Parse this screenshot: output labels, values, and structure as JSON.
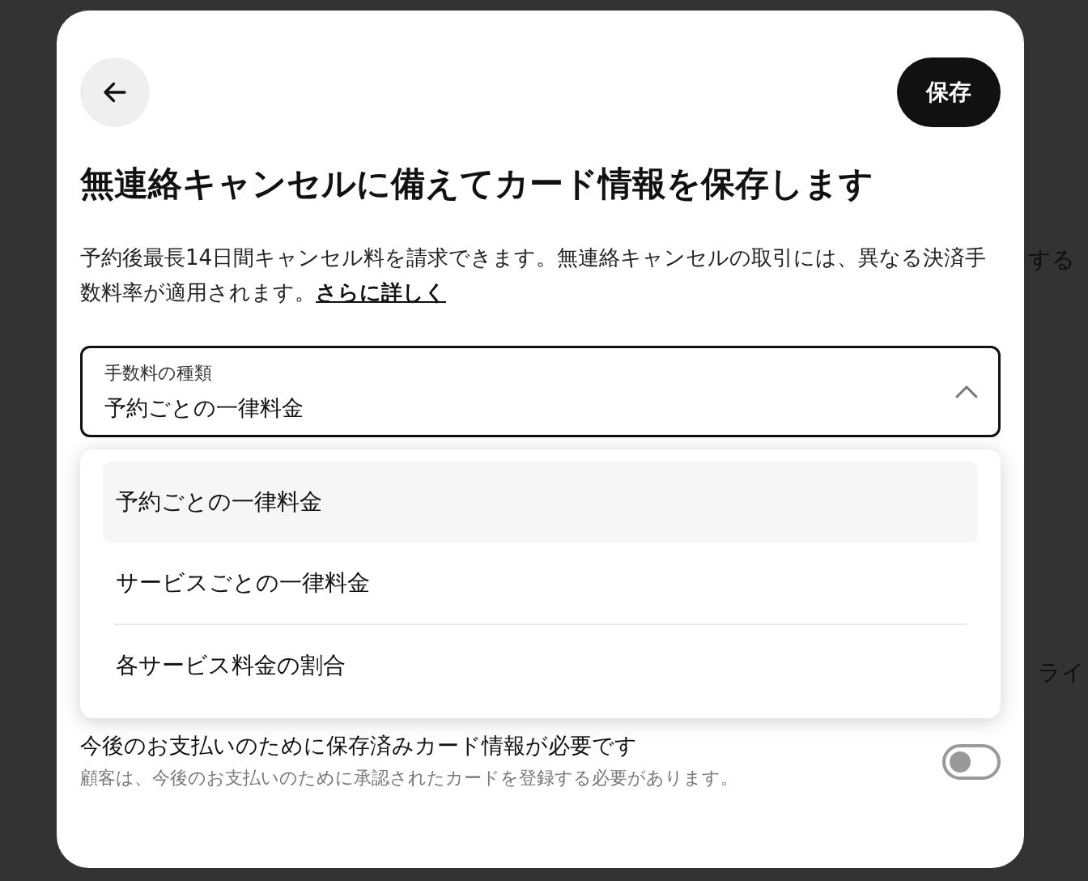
{
  "background": {
    "texts": [
      {
        "text": "する"
      },
      {
        "text": "ライ"
      }
    ]
  },
  "dialog": {
    "save_button": "保存",
    "title": "無連絡キャンセルに備えてカード情報を保存します",
    "description": "予約後最長14日間キャンセル料を請求できます。無連絡キャンセルの取引には、異なる決済手数料率が適用されます。",
    "learn_more_link": "さらに詳しく",
    "select": {
      "label": "手数料の種類",
      "value": "予約ごとの一律料金",
      "expanded": true,
      "options": [
        {
          "label": "予約ごとの一律料金",
          "selected": true
        },
        {
          "label": "サービスごとの一律料金",
          "selected": false
        },
        {
          "label": "各サービス料金の割合",
          "selected": false
        }
      ]
    },
    "card_requirement": {
      "title": "今後のお支払いのために保存済みカード情報が必要です",
      "description": "顧客は、今後のお支払いのために承認されたカードを登録する必要があります。",
      "on": false
    }
  }
}
